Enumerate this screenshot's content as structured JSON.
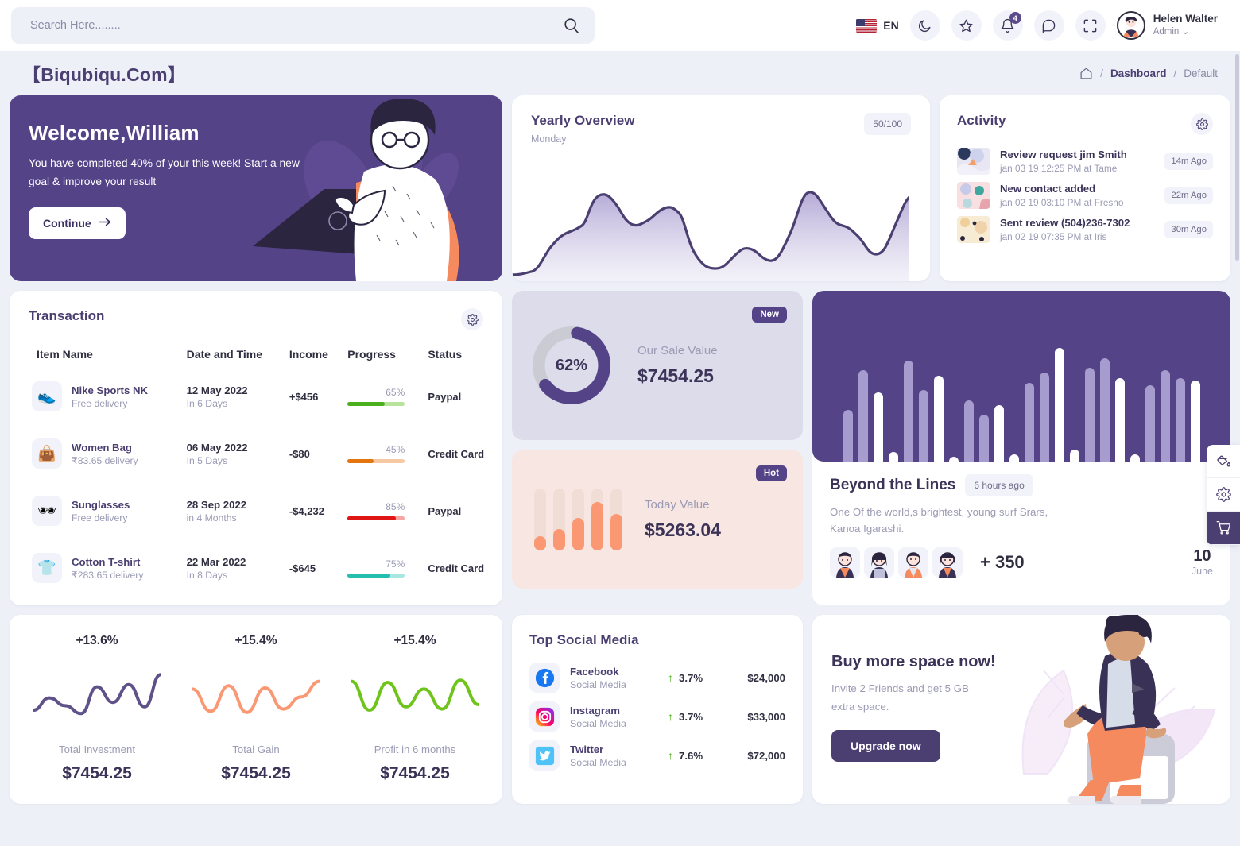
{
  "header": {
    "search_placeholder": "Search Here........",
    "search_value": "",
    "language": "EN",
    "notification_count": "4",
    "user_name": "Helen Walter",
    "user_role": "Admin",
    "icons": [
      "moon-icon",
      "star-icon",
      "bell-icon",
      "chat-icon",
      "fullscreen-icon"
    ]
  },
  "breadcrumb": {
    "brand": "【Biqubiqu.Com】",
    "home": "home-icon",
    "sep1": "/",
    "dashboard": "Dashboard",
    "sep2": "/",
    "current": "Default"
  },
  "welcome": {
    "title": "Welcome,William",
    "message": "You have completed 40% of your this week! Start a new goal & improve your result",
    "button": "Continue"
  },
  "yearly": {
    "title": "Yearly Overview",
    "subtitle": "Monday",
    "badge": "50/100"
  },
  "activity": {
    "title": "Activity",
    "items": [
      {
        "title": "Review request jim Smith",
        "meta": "jan 03 19 12:25 PM at Tame",
        "time": "14m Ago"
      },
      {
        "title": "New contact added",
        "meta": "jan 02 19 03:10 PM at Fresno",
        "time": "22m Ago"
      },
      {
        "title": "Sent review (504)236-7302",
        "meta": "jan 02 19 07:35 PM at Iris",
        "time": "30m Ago"
      }
    ]
  },
  "transaction": {
    "title": "Transaction",
    "columns": [
      "Item Name",
      "Date and Time",
      "Income",
      "Progress",
      "Status"
    ],
    "rows": [
      {
        "icon": "sneaker-icon",
        "glyph": "👟",
        "name": "Nike Sports NK",
        "delivery": "Free delivery",
        "date": "12 May 2022",
        "eta": "In 6 Days",
        "income": "+$456",
        "progress": "65%",
        "progress_value": 65,
        "progress_color": "#4caf1e",
        "progress_track": "#b8e39b",
        "status": "Paypal"
      },
      {
        "icon": "handbag-icon",
        "glyph": "👜",
        "name": "Women Bag",
        "delivery": "₹83.65 delivery",
        "date": "06 May 2022",
        "eta": "In 5 Days",
        "income": "-$80",
        "progress": "45%",
        "progress_value": 45,
        "progress_color": "#e2760c",
        "progress_track": "#f5c9a3",
        "status": "Credit Card"
      },
      {
        "icon": "sunglasses-icon",
        "glyph": "🕶",
        "name": "Sunglasses",
        "delivery": "Free delivery",
        "date": "28 Sep 2022",
        "eta": "in 4 Months",
        "income": "-$4,232",
        "progress": "85%",
        "progress_value": 85,
        "progress_color": "#e01616",
        "progress_track": "#f6a5a5",
        "status": "Paypal"
      },
      {
        "icon": "tshirt-icon",
        "glyph": "👕",
        "name": "Cotton T-shirt",
        "delivery": "₹283.65 delivery",
        "date": "22 Mar 2022",
        "eta": "In 8 Days",
        "income": "-$645",
        "progress": "75%",
        "progress_value": 75,
        "progress_color": "#25bfb0",
        "progress_track": "#abe7e1",
        "status": "Credit Card"
      }
    ]
  },
  "sale_card": {
    "tag": "New",
    "percent": "62%",
    "percent_value": 62,
    "caption": "Our Sale Value",
    "value": "$7454.25"
  },
  "today_card": {
    "tag": "Hot",
    "caption": "Today Value",
    "value": "$5263.04"
  },
  "beyond": {
    "title": "Beyond the Lines",
    "time_badge": "6 hours ago",
    "description": "One Of the world,s brightest, young surf Srars, Kanoa Igarashi.",
    "plus_count": "+ 350",
    "date_day": "10",
    "date_month": "June"
  },
  "stats": [
    {
      "pct": "+13.6%",
      "caption": "Total Investment",
      "value": "$7454.25",
      "color": "#5f5189"
    },
    {
      "pct": "+15.4%",
      "caption": "Total Gain",
      "value": "$7454.25",
      "color": "#fb9874"
    },
    {
      "pct": "+15.4%",
      "caption": "Profit in 6 months",
      "value": "$7454.25",
      "color": "#6ec41b"
    }
  ],
  "social": {
    "title": "Top Social Media",
    "items": [
      {
        "icon": "facebook-icon",
        "name": "Facebook",
        "sub": "Social Media",
        "change": "3.7%",
        "amount": "$24,000"
      },
      {
        "icon": "instagram-icon",
        "name": "Instagram",
        "sub": "Social Media",
        "change": "3.7%",
        "amount": "$33,000"
      },
      {
        "icon": "twitter-icon",
        "name": "Twitter",
        "sub": "Social Media",
        "change": "7.6%",
        "amount": "$72,000"
      }
    ]
  },
  "buy": {
    "title": "Buy more space now!",
    "description": "Invite 2 Friends and get 5 GB extra space.",
    "button": "Upgrade now"
  },
  "float_panel": [
    {
      "icon": "paint-bucket-icon",
      "active": false
    },
    {
      "icon": "gear-icon",
      "active": false
    },
    {
      "icon": "cart-icon",
      "active": true
    }
  ],
  "chart_data": [
    {
      "type": "area",
      "title": "Yearly Overview",
      "name": "yearly-overview",
      "x": [
        0,
        1,
        2,
        3,
        4,
        5,
        6,
        7,
        8,
        9,
        10,
        11,
        12,
        13,
        14,
        15,
        16,
        17,
        18,
        19,
        20,
        21,
        22,
        23,
        24
      ],
      "values": [
        4,
        4,
        6,
        22,
        38,
        40,
        56,
        72,
        52,
        50,
        60,
        64,
        38,
        12,
        14,
        26,
        30,
        22,
        24,
        68,
        78,
        62,
        56,
        34,
        74
      ],
      "ylim": [
        0,
        100
      ],
      "color": "#4b3f72",
      "grid": false,
      "legend": "none"
    },
    {
      "type": "pie",
      "name": "our-sale-value-donut",
      "title": "Our Sale Value",
      "labels": [
        "Completed",
        "Remaining"
      ],
      "values": [
        62,
        38
      ],
      "colors": [
        "#554388",
        "#cbcbd4"
      ],
      "center_label": "62%"
    },
    {
      "type": "bar",
      "name": "today-value-minibars",
      "title": "Today Value",
      "categories": [
        "1",
        "2",
        "3",
        "4",
        "5"
      ],
      "values": [
        22,
        34,
        52,
        78,
        58
      ],
      "ylim": [
        0,
        100
      ],
      "color": "#fb9874",
      "track_color": "#f0ded6"
    },
    {
      "type": "bar",
      "name": "beyond-the-lines-bars",
      "title": "Beyond the Lines",
      "categories": [
        "1",
        "2",
        "3",
        "4",
        "5",
        "6",
        "7",
        "8",
        "9",
        "10",
        "11",
        "12",
        "13",
        "14",
        "15",
        "16",
        "17",
        "18",
        "19",
        "20",
        "21",
        "22",
        "23",
        "24"
      ],
      "values": [
        42,
        74,
        56,
        8,
        82,
        58,
        70,
        4,
        50,
        38,
        46,
        6,
        64,
        72,
        92,
        10,
        76,
        84,
        68,
        6,
        62,
        74,
        68,
        66
      ],
      "series_colors": [
        "#a69ccd",
        "#a69ccd",
        "#ffffff",
        "#ffffff",
        "#a69ccd",
        "#a69ccd",
        "#ffffff",
        "#ffffff",
        "#a69ccd",
        "#a69ccd",
        "#ffffff",
        "#ffffff",
        "#a69ccd",
        "#a69ccd",
        "#ffffff",
        "#ffffff",
        "#a69ccd",
        "#a69ccd",
        "#ffffff",
        "#ffffff",
        "#a69ccd",
        "#a69ccd",
        "#a69ccd",
        "#ffffff"
      ],
      "ylim": [
        0,
        100
      ],
      "background": "#554388"
    },
    {
      "type": "line",
      "name": "total-investment-sparkline",
      "title": "Total Investment",
      "values": [
        20,
        42,
        28,
        14,
        62,
        34,
        66,
        26,
        84
      ],
      "color": "#5f5189"
    },
    {
      "type": "line",
      "name": "total-gain-sparkline",
      "title": "Total Gain",
      "values": [
        58,
        18,
        64,
        16,
        60,
        22,
        44,
        72
      ],
      "color": "#fb9874"
    },
    {
      "type": "line",
      "name": "profit-6-months-sparkline",
      "title": "Profit in 6 months",
      "values": [
        72,
        20,
        70,
        26,
        58,
        22,
        74,
        30
      ],
      "color": "#6ec41b"
    }
  ]
}
